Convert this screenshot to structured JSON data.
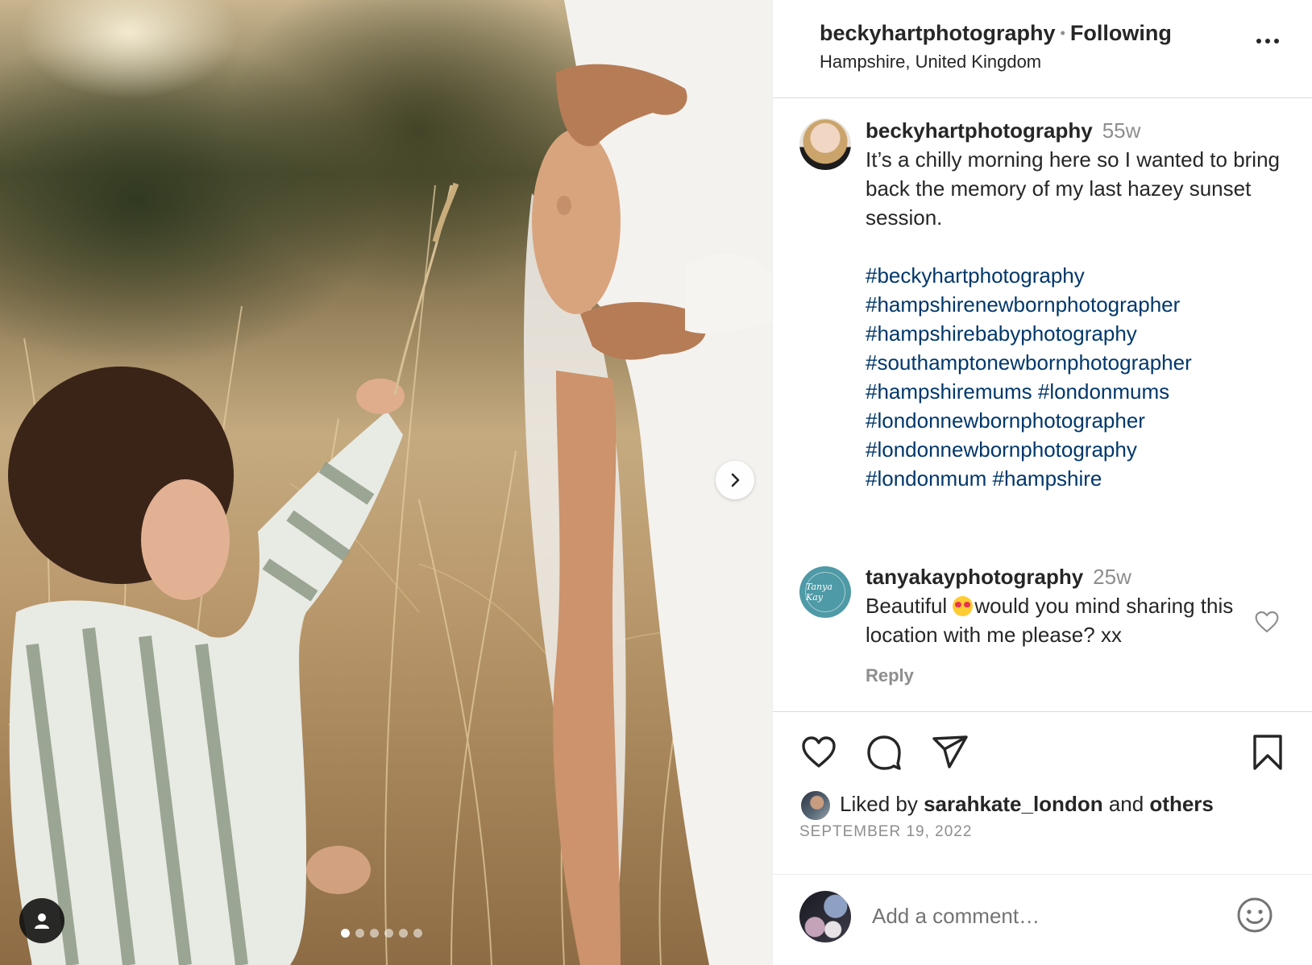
{
  "post": {
    "username": "beckyhartphotography",
    "bullet": "•",
    "follow_status": "Following",
    "location": "Hampshire, United Kingdom",
    "more_icon": "more-horizontal-icon"
  },
  "photo": {
    "next_icon": "chevron-right-icon",
    "tag_icon": "person-icon",
    "carousel_dots": 6,
    "active_dot": 0
  },
  "caption": {
    "username": "beckyhartphotography",
    "time": "55w",
    "text": "It’s a chilly morning here so I wanted to bring back the memory of my last hazey sunset session.",
    "hashtags": [
      "#beckyhartphotography",
      "#hampshirenewbornphotographer",
      "#hampshirebabyphotography",
      "#southamptonewbornphotographer",
      "#hampshiremums #londonmums",
      "#londonnewbornphotographer",
      "#londonnewbornphotography",
      "#londonmum #hampshire"
    ]
  },
  "comment": {
    "username": "tanyakayphotography",
    "time": "25w",
    "text_before": "Beautiful ",
    "emoji": "heart-eyes-emoji",
    "text_after": "would you mind sharing this location with me please? xx",
    "reply_label": "Reply",
    "avatar_text": "Tanya Kay"
  },
  "actions": {
    "like_icon": "heart-icon",
    "comment_icon": "comment-icon",
    "share_icon": "send-icon",
    "save_icon": "bookmark-icon"
  },
  "likes": {
    "prefix": "Liked by ",
    "user": "sarahkate_london",
    "middle": " and ",
    "others": "others"
  },
  "date": "SEPTEMBER 19, 2022",
  "add_comment": {
    "placeholder": "Add a comment…",
    "emoji_icon": "smiley-icon"
  },
  "colors": {
    "hashtag": "#00376b",
    "muted": "#8e8e8e",
    "text": "#262626",
    "tanya_avatar": "#4e9aa6"
  }
}
